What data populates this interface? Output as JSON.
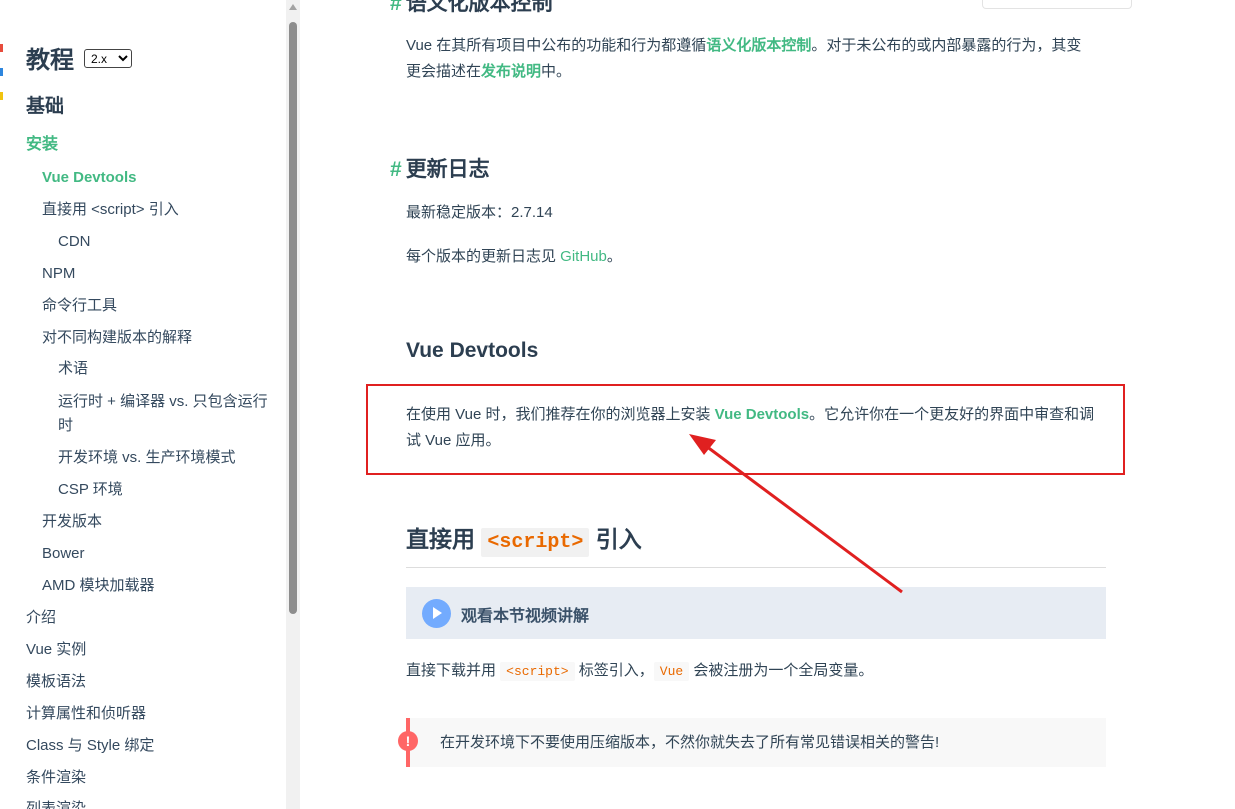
{
  "sidebar": {
    "title": "教程",
    "version_select": {
      "selected": "2.x"
    },
    "section": "基础",
    "items": [
      {
        "label": "安装",
        "level": 1,
        "state": "section-active"
      },
      {
        "label": "Vue Devtools",
        "level": 2,
        "state": "active"
      },
      {
        "label": "直接用 <script> 引入",
        "level": 2
      },
      {
        "label": "CDN",
        "level": 3
      },
      {
        "label": "NPM",
        "level": 2
      },
      {
        "label": "命令行工具",
        "level": 2
      },
      {
        "label": "对不同构建版本的解释",
        "level": 2
      },
      {
        "label": "术语",
        "level": 3
      },
      {
        "label": "运行时 + 编译器 vs. 只包含运行时",
        "level": 3
      },
      {
        "label": "开发环境 vs. 生产环境模式",
        "level": 3
      },
      {
        "label": "CSP 环境",
        "level": 3
      },
      {
        "label": "开发版本",
        "level": 2
      },
      {
        "label": "Bower",
        "level": 2
      },
      {
        "label": "AMD 模块加载器",
        "level": 2
      },
      {
        "label": "介绍",
        "level": 1
      },
      {
        "label": "Vue 实例",
        "level": 1
      },
      {
        "label": "模板语法",
        "level": 1
      },
      {
        "label": "计算属性和侦听器",
        "level": 1
      },
      {
        "label": "Class 与 Style 绑定",
        "level": 1
      },
      {
        "label": "条件渲染",
        "level": 1
      },
      {
        "label": "列表渲染",
        "level": 1
      }
    ]
  },
  "main": {
    "top_heading": "语义化版本控制",
    "semver": {
      "text_before": "Vue 在其所有项目中公布的功能和行为都遵循",
      "link1": "语义化版本控制",
      "text_mid": "。对于未公布的或内部暴露的行为，其变更会描述在",
      "link2": "发布说明",
      "text_after": "中。"
    },
    "changelog": {
      "anchor": "#",
      "heading": "更新日志",
      "stable_label": "最新稳定版本：",
      "stable_version": "2.7.14",
      "each_before": "每个版本的更新日志见 ",
      "each_link": "GitHub",
      "each_after": "。"
    },
    "devtools": {
      "heading": "Vue Devtools",
      "text_before": "在使用 Vue 时，我们推荐在你的浏览器上安装 ",
      "link": "Vue Devtools",
      "text_after": "。它允许你在一个更友好的界面中审查和调试 Vue 应用。"
    },
    "direct": {
      "heading_before": "直接用 ",
      "heading_code": "<script>",
      "heading_after": " 引入",
      "video_label": "观看本节视频讲解",
      "text_before": "直接下载并用 ",
      "code1": "<script>",
      "text_mid": " 标签引入，",
      "code2": "Vue",
      "text_after": " 会被注册为一个全局变量。",
      "warning_icon": "!",
      "warning": "在开发环境下不要使用压缩版本，不然你就失去了所有常见错误相关的警告!"
    }
  },
  "colors": {
    "accent": "#42b983",
    "text": "#2c3e50",
    "annotation": "#e02020",
    "warning": "#ff6666",
    "video_bg": "#e7ecf3",
    "play": "#73abfe"
  },
  "icons": [
    "play-icon",
    "warning-icon",
    "scroll-up-arrow-icon"
  ]
}
